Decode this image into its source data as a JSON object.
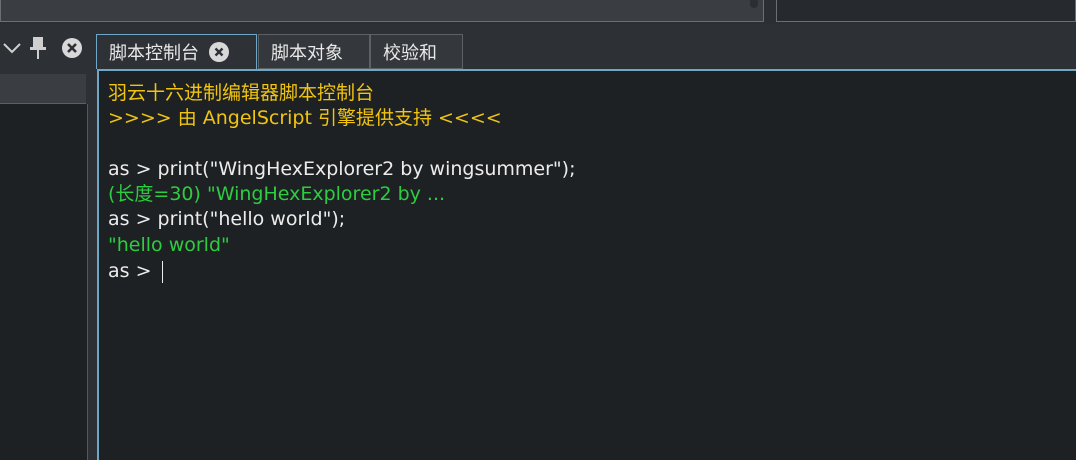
{
  "tabs": [
    {
      "label": "脚本控制台",
      "active": true
    },
    {
      "label": "脚本对象",
      "active": false
    },
    {
      "label": "校验和",
      "active": false
    }
  ],
  "console": {
    "lines": [
      {
        "text": "羽云十六进制编辑器脚本控制台",
        "color": "#f1c40f"
      },
      {
        "text": ">>>> 由 AngelScript 引擎提供支持 <<<<",
        "color": "#f1c40f"
      },
      {
        "text": "as > print(\"WingHexExplorer2 by wingsummer\");",
        "color": "#ececec"
      },
      {
        "text": "(长度=30) \"WingHexExplorer2 by ...",
        "color": "#2ecc40"
      },
      {
        "text": "as > print(\"hello world\");",
        "color": "#ececec"
      },
      {
        "text": "\"hello world\"",
        "color": "#2ecc40"
      },
      {
        "text": "as > ",
        "color": "#ececec"
      }
    ]
  },
  "dock_icons": [
    "chevron-down-icon",
    "pin-icon",
    "close-icon"
  ]
}
